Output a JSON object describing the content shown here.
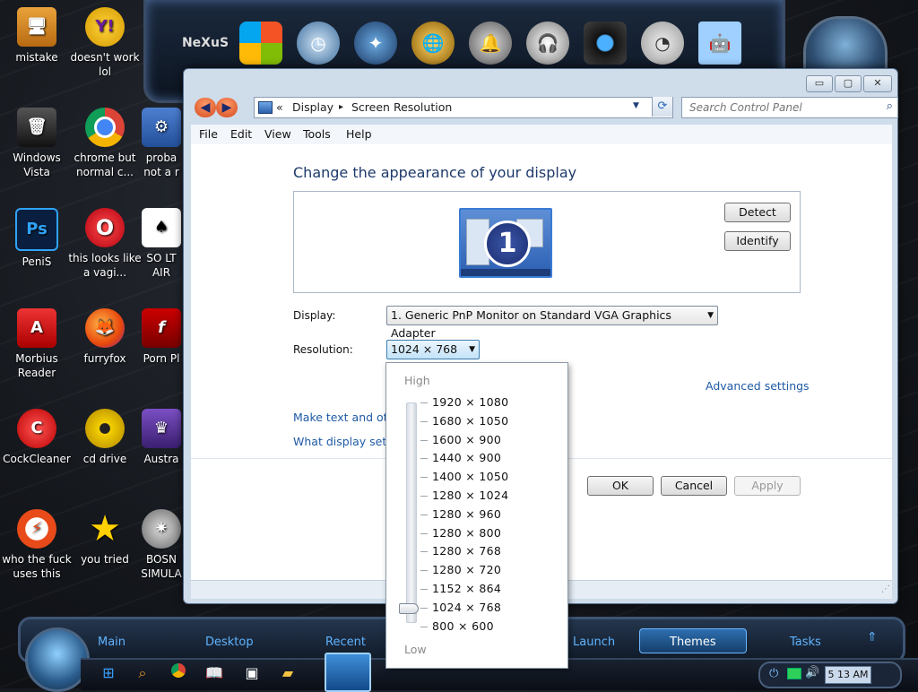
{
  "desktop_icons": [
    {
      "label": "mistake",
      "x": 0,
      "y": 8
    },
    {
      "label": "doesn't work lol"
    },
    {
      "label": "Windows Vista"
    },
    {
      "label": "chrome but normal c..."
    },
    {
      "label": "proba not a r"
    },
    {
      "label": "PeniS"
    },
    {
      "label": "this looks like a vagi..."
    },
    {
      "label": "SO LT AIR"
    },
    {
      "label": "Morbius Reader"
    },
    {
      "label": "furryfox"
    },
    {
      "label": "Porn Pl"
    },
    {
      "label": "CockCleaner"
    },
    {
      "label": "cd drive"
    },
    {
      "label": "Austra"
    },
    {
      "label": "who the fuck uses this"
    },
    {
      "label": "you tried"
    },
    {
      "label": "BOSN SIMULA"
    }
  ],
  "window": {
    "breadcrumb": {
      "prefix": "«",
      "item1": "Display",
      "sep": "▸",
      "item2": "Screen Resolution"
    },
    "search_placeholder": "Search Control Panel",
    "controls": {
      "minimize": "▭",
      "maximize": "▢",
      "close": "✕"
    },
    "menu": [
      "File",
      "Edit",
      "View",
      "Tools",
      "Help"
    ],
    "heading": "Change the appearance of your display",
    "monitor_number": "1",
    "detect_label": "Detect",
    "identify_label": "Identify",
    "display_label": "Display:",
    "display_value": "1. Generic PnP Monitor on Standard VGA Graphics Adapter",
    "resolution_label": "Resolution:",
    "resolution_value": "1024 × 768",
    "advanced_settings": "Advanced settings",
    "link1": "Make text and oth",
    "link2": "What display setti",
    "ok_label": "OK",
    "cancel_label": "Cancel",
    "apply_label": "Apply"
  },
  "resolution_dropdown": {
    "high_label": "High",
    "low_label": "Low",
    "options": [
      "1920 × 1080",
      "1680 × 1050",
      "1600 × 900",
      "1440 × 900",
      "1400 × 1050",
      "1280 × 1024",
      "1280 × 960",
      "1280 × 800",
      "1280 × 768",
      "1280 × 720",
      "1152 × 864",
      "1024 × 768",
      "800 × 600"
    ],
    "selected_index": 11
  },
  "bottom_dock": {
    "tabs": [
      "Main",
      "Desktop",
      "Recent",
      "Launch",
      "Themes",
      "Tasks"
    ],
    "active_tab": "Themes"
  },
  "taskbar": {
    "clock": "5 13 AM"
  }
}
